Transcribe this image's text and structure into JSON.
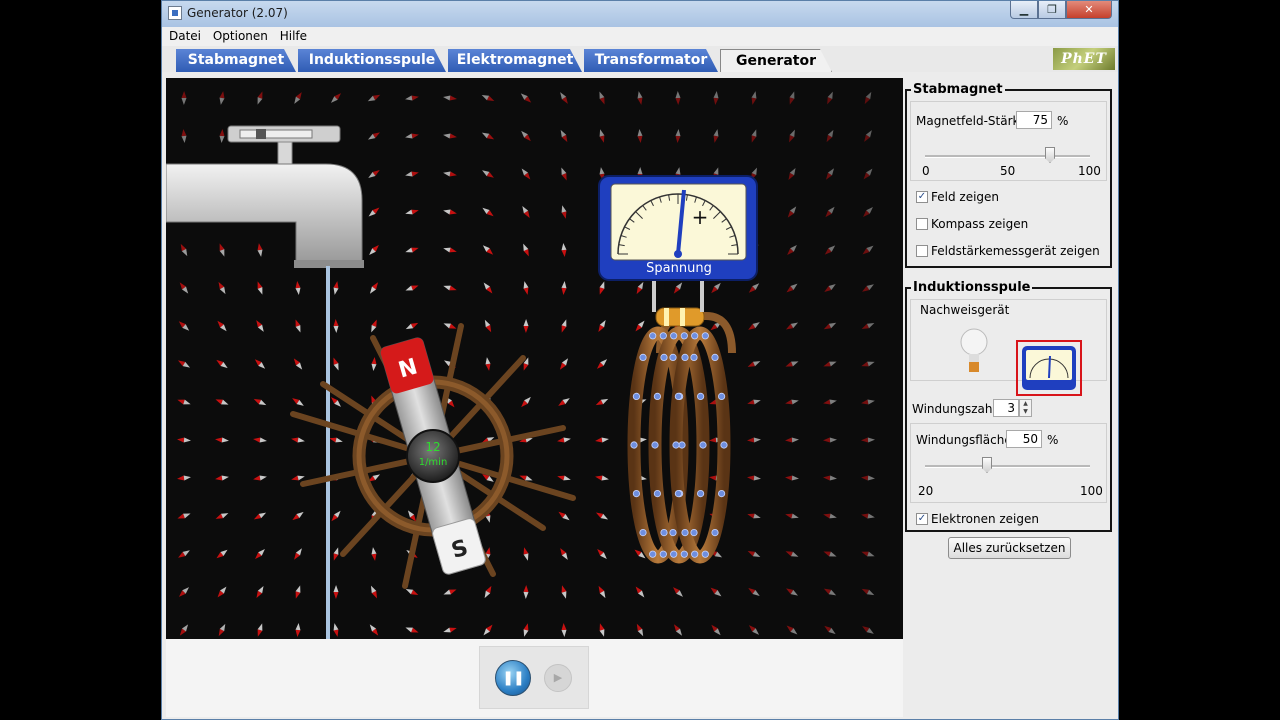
{
  "window": {
    "title": "Generator (2.07)",
    "controls": [
      "▁",
      "❐",
      "✕"
    ]
  },
  "menu": [
    "Datei",
    "Optionen",
    "Hilfe"
  ],
  "tabs": [
    "Stabmagnet",
    "Induktionsspule",
    "Elektromagnet",
    "Transformator",
    "Generator"
  ],
  "active_tab": "Generator",
  "logo": "PhET",
  "canvas": {
    "meter_label": "Spannung",
    "meter_plus": "+",
    "magnet_north": "N",
    "magnet_south": "S",
    "wheel_rpm": "12",
    "wheel_unit": "1/min"
  },
  "stabmagnet": {
    "title": "Stabmagnet",
    "strength_label": "Magnetfeld-Stärke:",
    "strength_value": "75",
    "unit": "%",
    "slider_value": 75,
    "ticks": [
      "0",
      "50",
      "100"
    ],
    "checks": [
      {
        "label": "Feld zeigen",
        "checked": true
      },
      {
        "label": "Kompass zeigen",
        "checked": false
      },
      {
        "label": "Feldstärkemessgerät zeigen",
        "checked": false
      }
    ]
  },
  "induktionsspule": {
    "title": "Induktionsspule",
    "indicator_label": "Nachweisgerät",
    "turns_label": "Windungszahl:",
    "turns_value": "3",
    "area_label": "Windungsfläche:",
    "area_value": "50",
    "unit": "%",
    "area_slider_value": 50,
    "area_ticks": [
      "20",
      "100"
    ],
    "electrons_label": "Elektronen zeigen",
    "electrons_checked": true
  },
  "reset_button": "Alles zurücksetzen",
  "playback": {
    "pause_symbol": "❚❚",
    "step_symbol": "▶"
  },
  "colors": {
    "tab_blue": "#2f5cb4",
    "selection_red": "#d8141a",
    "rpm_green": "#2fdc2f"
  }
}
